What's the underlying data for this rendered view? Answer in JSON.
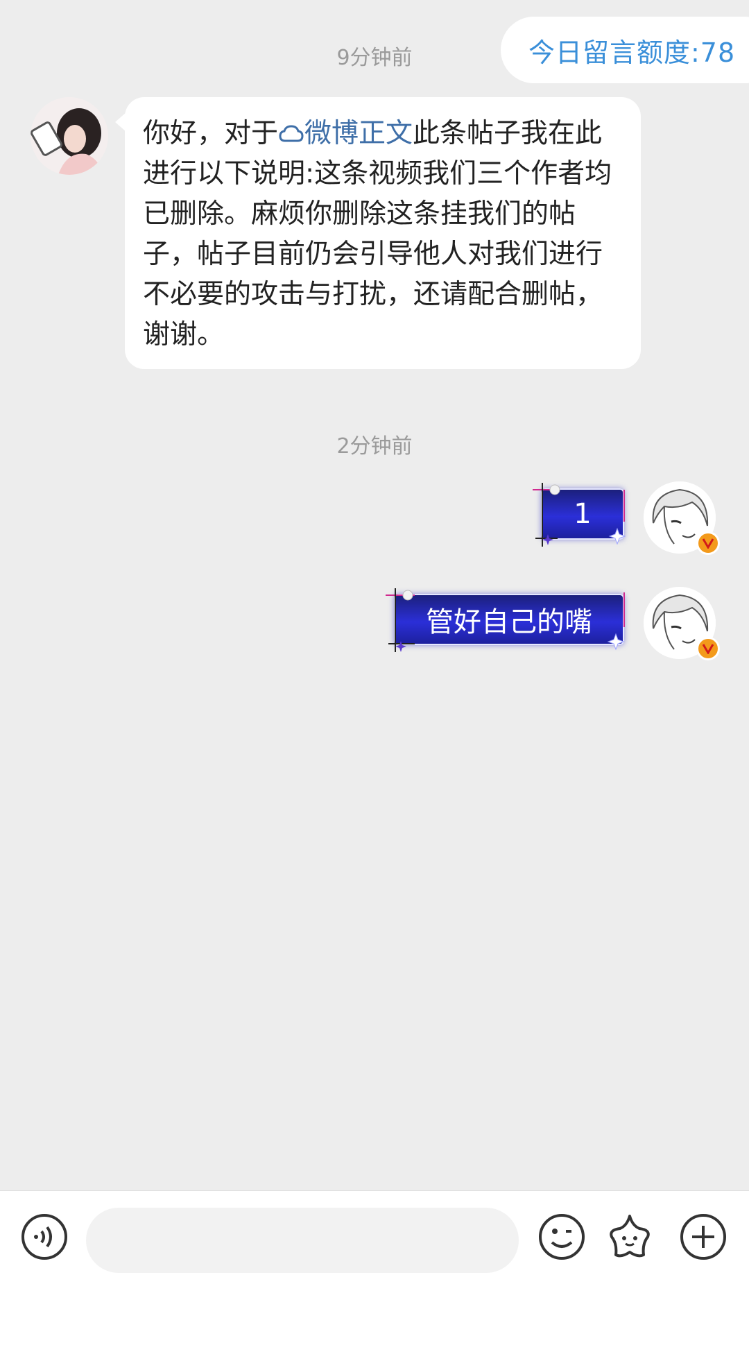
{
  "quota": {
    "label": "今日留言额度:78"
  },
  "messages": [
    {
      "time": "9分钟前",
      "side": "left",
      "text_before": "你好，对于",
      "link": "微博正文",
      "text_after": "此条帖子我在此进行以下说明:这条视频我们三个作者均已删除。麻烦你删除这条挂我们的帖子，帖子目前仍会引导他人对我们进行不必要的攻击与打扰，还请配合删帖，谢谢。"
    },
    {
      "time": "2分钟前",
      "side": "right",
      "text": "1"
    },
    {
      "side": "right",
      "text": "管好自己的嘴"
    }
  ],
  "input": {
    "placeholder": ""
  },
  "icons": {
    "voice": "voice-icon",
    "emoji": "emoji-icon",
    "sticker": "star-sticker-icon",
    "add": "plus-icon",
    "link": "cloud-icon",
    "verified": "verified-v-icon"
  },
  "colors": {
    "accent": "#3a8fd9",
    "link": "#3f6fa8",
    "background": "#ededed",
    "bubble_right": "#2b2fd8",
    "verified": "#f39a1b"
  }
}
